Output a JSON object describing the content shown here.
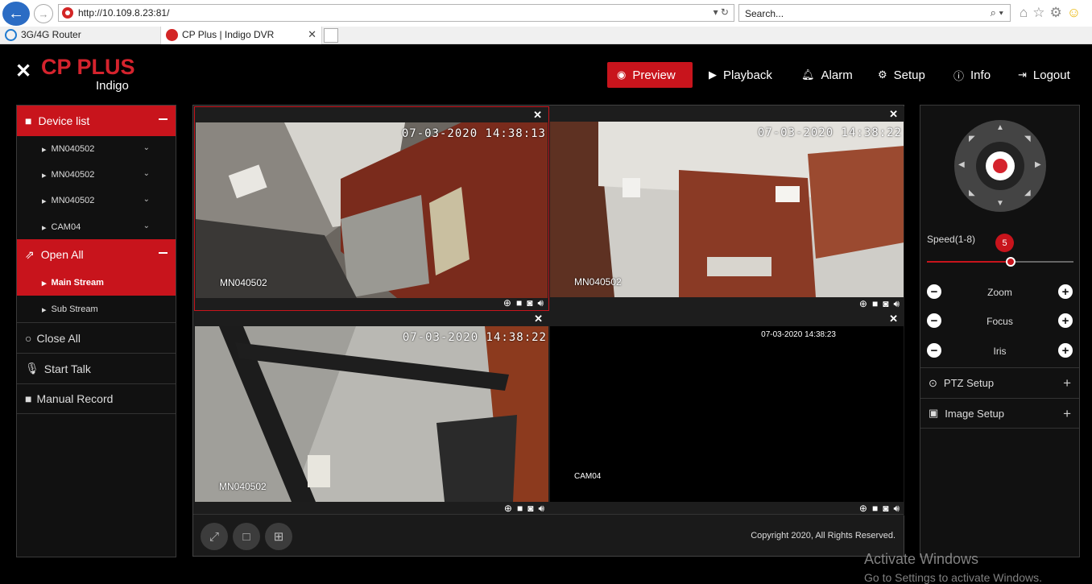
{
  "browser": {
    "url": "http://10.109.8.23:81/",
    "search_placeholder": "Search...",
    "tabs": [
      {
        "label": "3G/4G Router"
      },
      {
        "label": "CP Plus | Indigo DVR"
      }
    ]
  },
  "logo": {
    "mark": "✕",
    "brand": "CP PLUS",
    "sub": "Indigo"
  },
  "nav": {
    "preview": "Preview",
    "playback": "Playback",
    "alarm": "Alarm",
    "setup": "Setup",
    "info": "Info",
    "logout": "Logout"
  },
  "sidebar": {
    "device_list": "Device list",
    "devices": [
      "MN040502",
      "MN040502",
      "MN040502",
      "CAM04"
    ],
    "open_all": "Open All",
    "main_stream": "Main Stream",
    "sub_stream": "Sub Stream",
    "close_all": "Close All",
    "start_talk": "Start Talk",
    "manual_record": "Manual Record"
  },
  "cells": [
    {
      "timestamp": "07-03-2020 14:38:13",
      "camera": "MN040502"
    },
    {
      "timestamp": "07-03-2020 14:38:22",
      "camera": "MN040502"
    },
    {
      "timestamp": "07-03-2020 14:38:22",
      "camera": "MN040502"
    },
    {
      "timestamp": "07-03-2020 14:38:23",
      "camera": "CAM04"
    }
  ],
  "footer": {
    "copyright": "Copyright 2020, All Rights Reserved."
  },
  "ptz": {
    "speed_label": "Speed(1-8)",
    "speed_value": "5",
    "speed_fraction": 0.57,
    "zoom": "Zoom",
    "focus": "Focus",
    "iris": "Iris",
    "ptz_setup": "PTZ Setup",
    "image_setup": "Image Setup"
  },
  "watermark": {
    "line1": "Activate Windows",
    "line2": "Go to Settings to activate Windows."
  },
  "colors": {
    "accent": "#c8141c",
    "brand": "#d5232d"
  }
}
